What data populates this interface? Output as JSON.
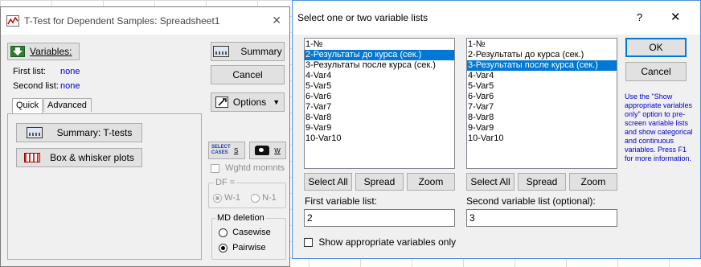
{
  "ttest_window": {
    "title": "T-Test for Dependent Samples: Spreadsheet1",
    "close_glyph": "✕",
    "variables_label": "Variables:",
    "first_list_label": "First list:",
    "first_list_value": "none",
    "second_list_label": "Second list:",
    "second_list_value": "none",
    "tabs": [
      {
        "label": "Quick"
      },
      {
        "label": "Advanced"
      }
    ],
    "summary_button": "Summary",
    "cancel_button": "Cancel",
    "options_button": "Options",
    "summary_ttests_button": "Summary: T-tests",
    "box_whisker_button": "Box & whisker plots",
    "select_cases_icon_text": "SELECT\nCASES",
    "select_cases_key": "S",
    "weight_key": "W",
    "wghtd_momnts_label": "Wghtd momnts",
    "df_group_title": "DF =",
    "df_options": [
      "W-1",
      "N-1"
    ],
    "md_group_title": "MD deletion",
    "md_options": [
      "Casewise",
      "Pairwise"
    ],
    "md_selected": "Pairwise"
  },
  "select_dialog": {
    "title": "Select one or two variable lists",
    "help_glyph": "?",
    "close_glyph": "✕",
    "variables": [
      "1-№",
      "2-Результаты  до курса (сек.)",
      "3-Результаты после курса (сек.)",
      "4-Var4",
      "5-Var5",
      "6-Var6",
      "7-Var7",
      "8-Var8",
      "9-Var9",
      "10-Var10"
    ],
    "left_selected_index": 1,
    "right_selected_index": 2,
    "select_all_button": "Select All",
    "spread_button": "Spread",
    "zoom_button": "Zoom",
    "first_list_label": "First variable list:",
    "first_list_value": "2",
    "second_list_label": "Second variable list (optional):",
    "second_list_value": "3",
    "show_appropriate_label": "Show appropriate variables only",
    "ok_button": "OK",
    "cancel_button": "Cancel",
    "help_text": "Use the \"Show appropriate variables only\" option to pre-screen variable lists and show categorical and continuous variables. Press F1 for more information."
  },
  "colors": {
    "selection": "#0078d7",
    "help_text": "#0000cc",
    "link_value": "#0000cc"
  }
}
